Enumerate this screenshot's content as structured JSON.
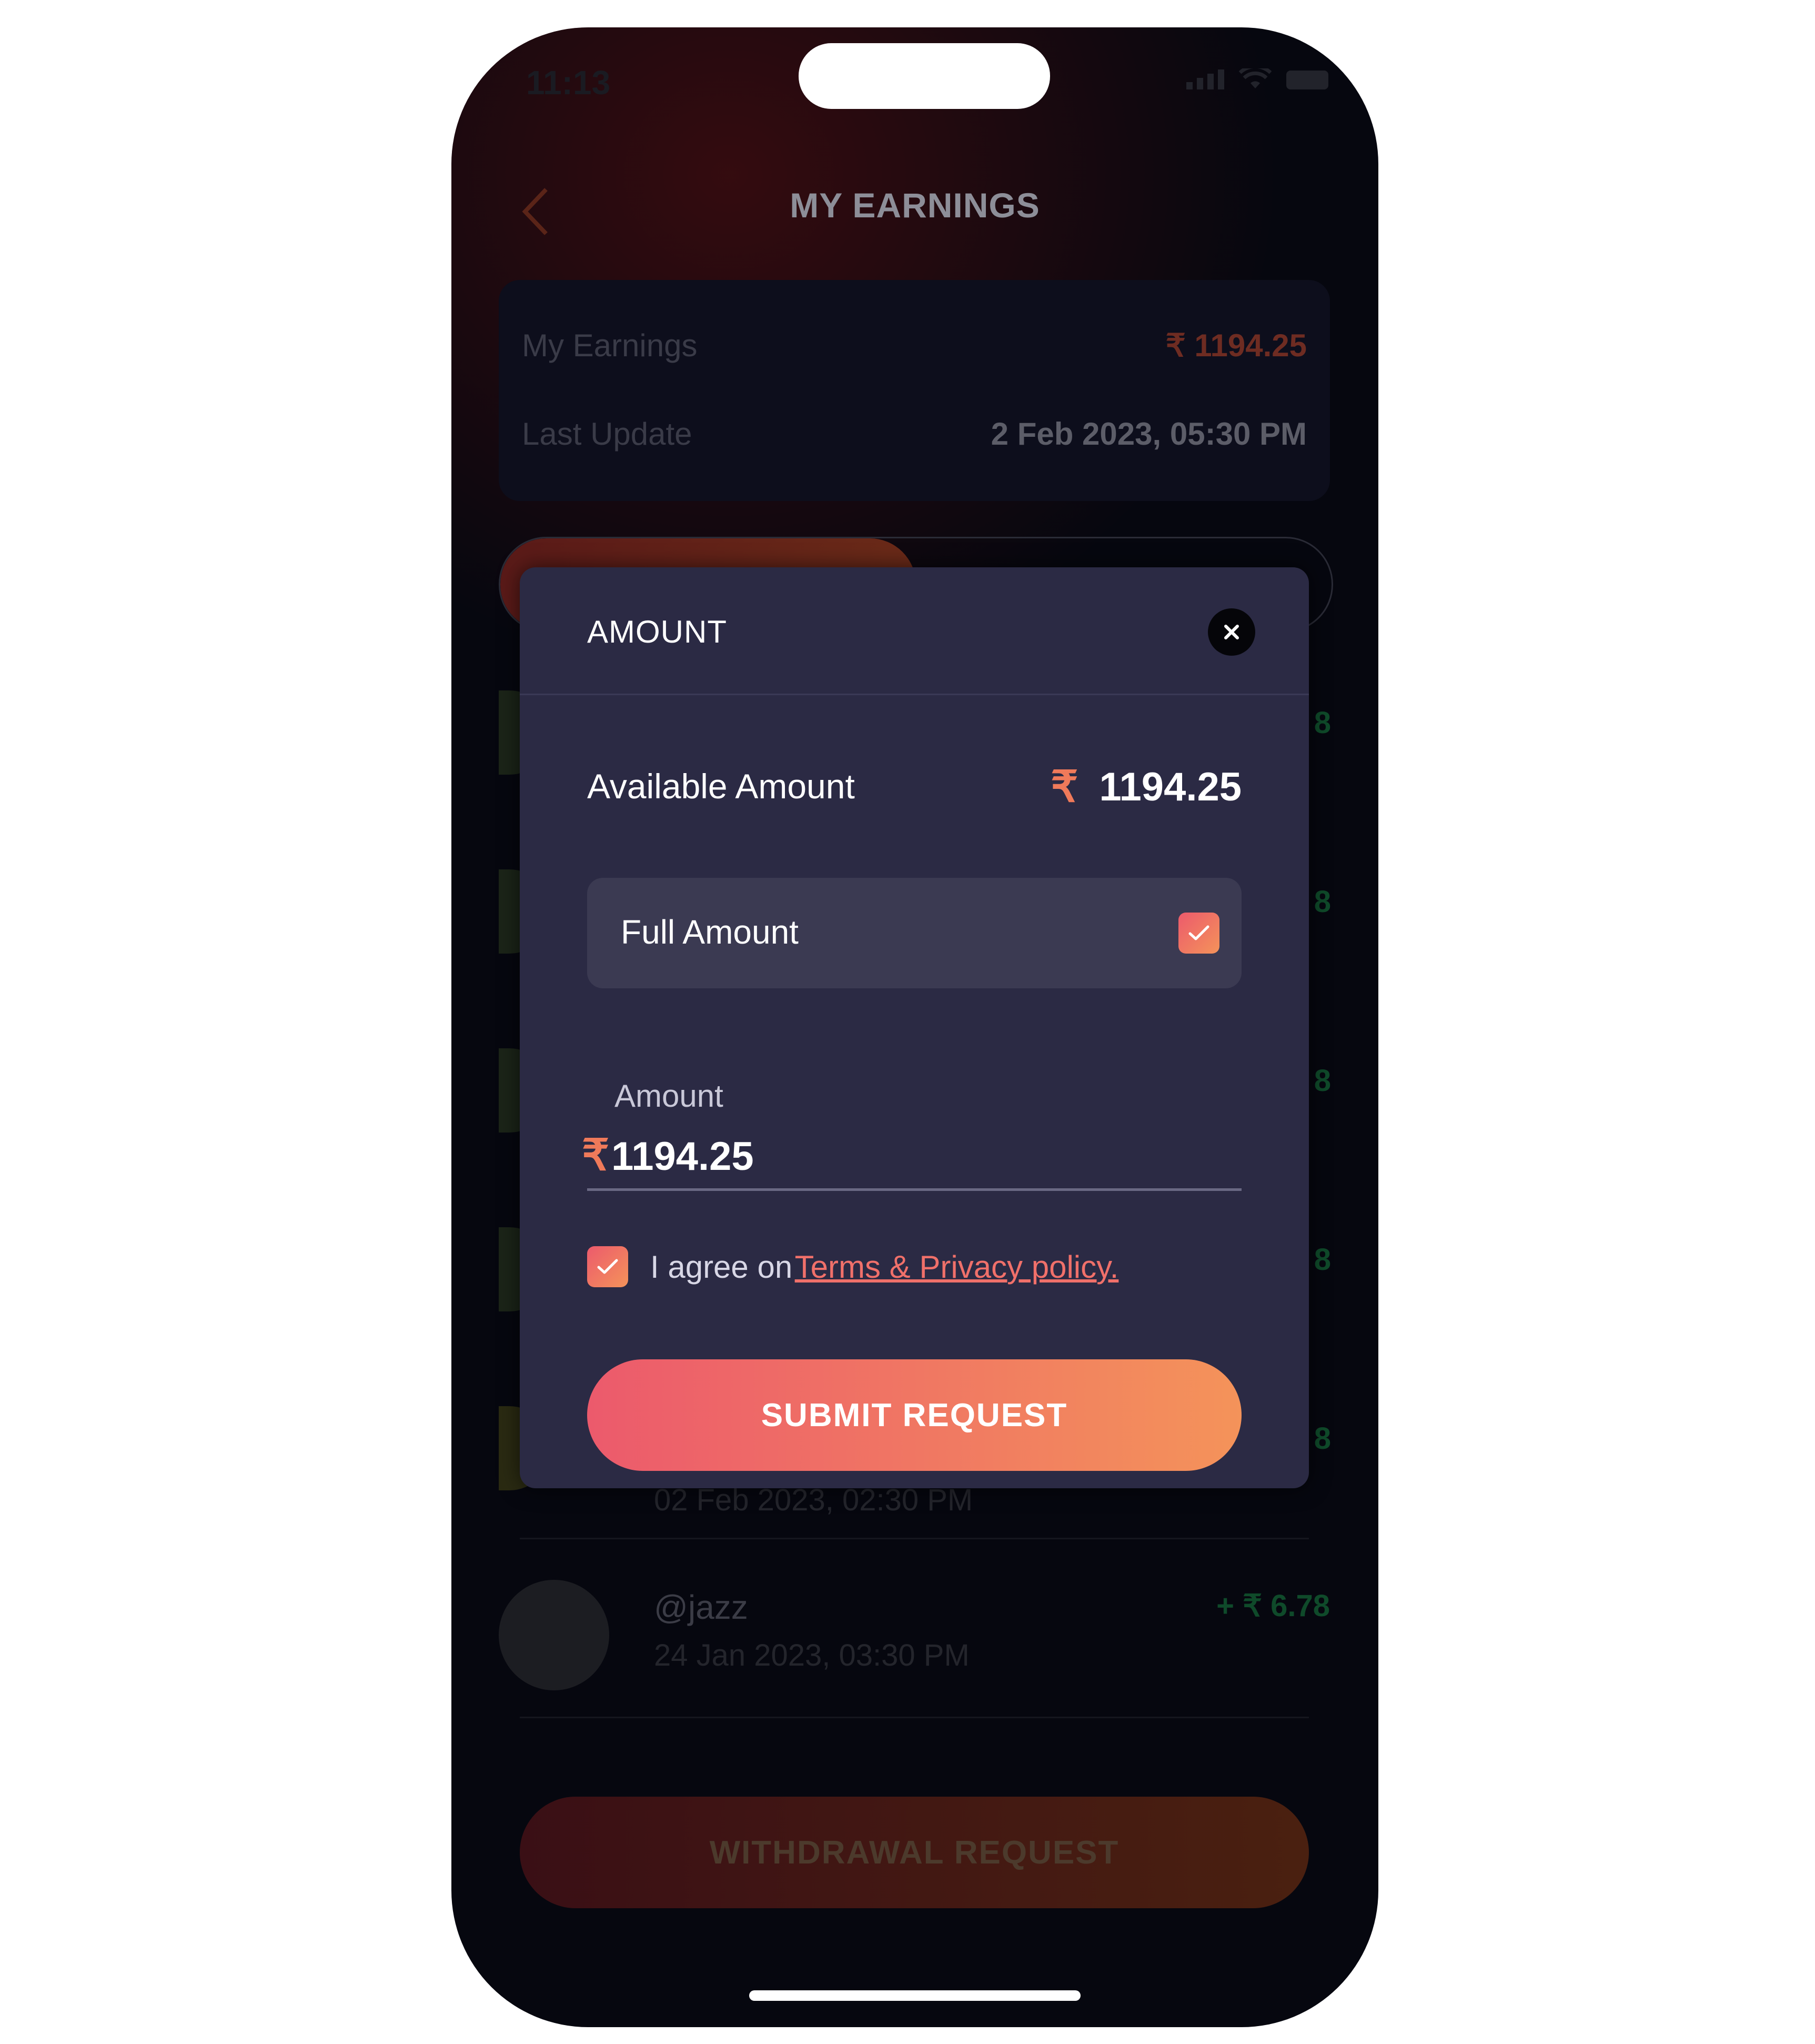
{
  "status_bar": {
    "time": "11:13"
  },
  "header": {
    "title": "MY EARNINGS"
  },
  "earnings": {
    "label": "My Earnings",
    "value": "₹ 1194.25",
    "update_label": "Last Update",
    "update_value": "2 Feb 2023, 05:30 PM"
  },
  "list": {
    "partial_amount": "8",
    "visible_date": "02 Feb 2023, 02:30 PM",
    "last_item": {
      "name": "@jazz",
      "date": "24 Jan 2023, 03:30 PM",
      "amount": "+ ₹ 6.78"
    }
  },
  "withdraw": {
    "label": "WITHDRAWAL REQUEST"
  },
  "modal": {
    "title": "AMOUNT",
    "available_label": "Available Amount",
    "currency_symbol": "₹",
    "available_value": "1194.25",
    "full_amount_label": "Full Amount",
    "full_amount_checked": true,
    "amount_label": "Amount",
    "amount_value": "1194.25",
    "agree_text": "I agree on",
    "terms_link": "Terms & Privacy policy.",
    "agree_checked": true,
    "submit_label": "SUBMIT REQUEST"
  },
  "colors": {
    "accent_start": "#ec5a6c",
    "accent_end": "#f4935a",
    "modal_bg": "#2b2a44",
    "screen_bg": "#06070f"
  }
}
